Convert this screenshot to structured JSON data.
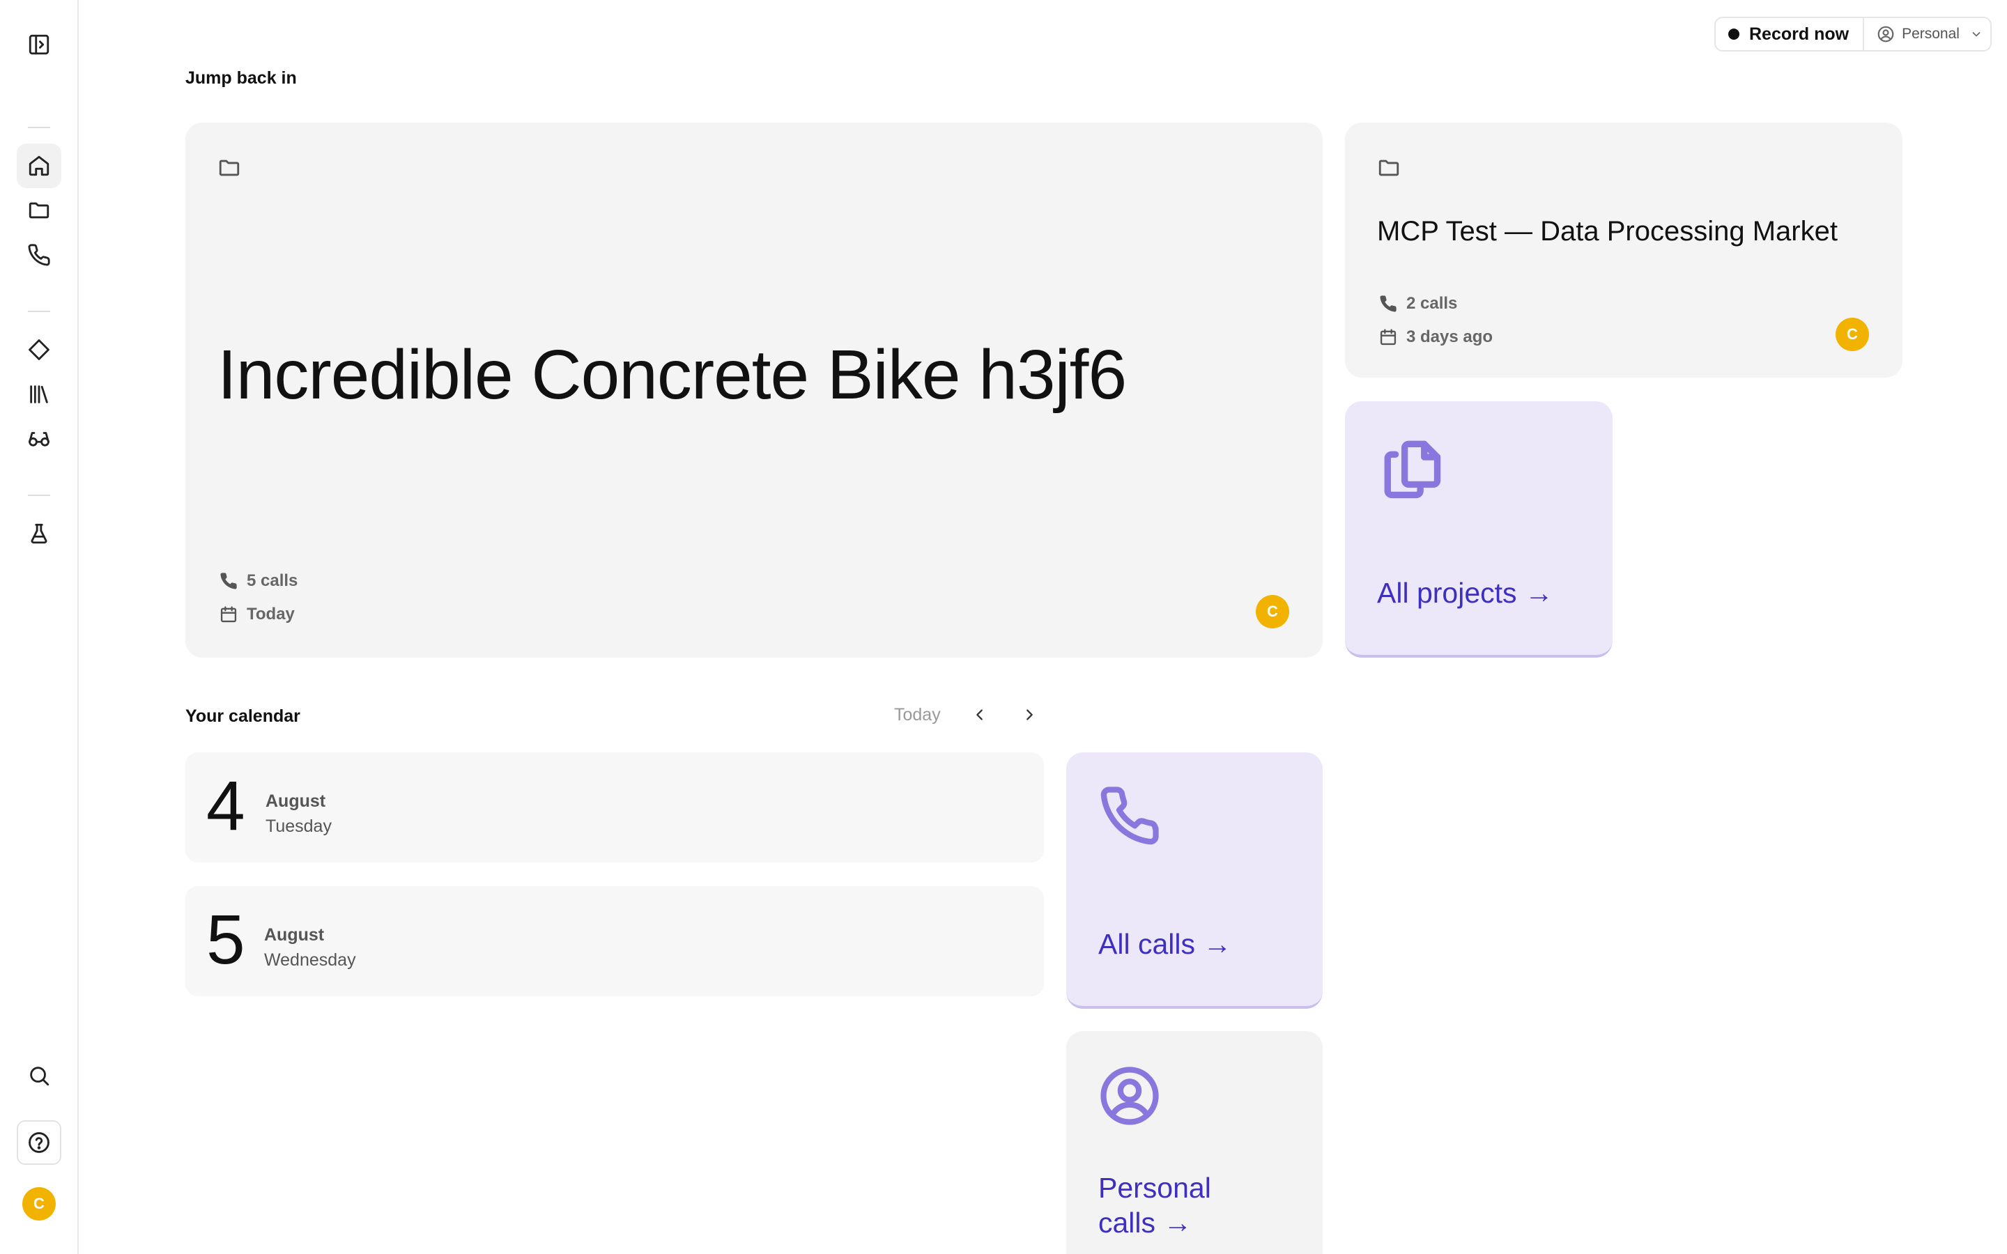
{
  "sidebar": {
    "items": [
      {
        "name": "toggle-sidebar",
        "icon": "panel-toggle-icon"
      },
      {
        "name": "home",
        "icon": "home-icon",
        "active": true
      },
      {
        "name": "projects",
        "icon": "folder-icon"
      },
      {
        "name": "calls",
        "icon": "phone-icon"
      },
      {
        "name": "tags",
        "icon": "diamond-icon"
      },
      {
        "name": "library",
        "icon": "library-icon"
      },
      {
        "name": "glasses",
        "icon": "glasses-icon"
      },
      {
        "name": "labs",
        "icon": "flask-icon"
      },
      {
        "name": "search",
        "icon": "search-icon"
      },
      {
        "name": "help",
        "icon": "help-icon"
      }
    ],
    "user_initial": "C"
  },
  "topbar": {
    "record_label": "Record now",
    "workspace_label": "Personal"
  },
  "jump_back": {
    "title": "Jump back in",
    "featured_project": {
      "title": "Incredible Concrete Bike h3jf6",
      "calls": "5 calls",
      "date": "Today",
      "owner_initial": "C"
    },
    "secondary_project": {
      "title": "MCP Test — Data Processing Market",
      "calls": "2 calls",
      "date": "3 days ago",
      "owner_initial": "C"
    },
    "all_projects_label": "All projects →"
  },
  "calendar": {
    "title": "Your calendar",
    "today_label": "Today",
    "days": [
      {
        "day": "4",
        "month": "August",
        "weekday": "Tuesday"
      },
      {
        "day": "5",
        "month": "August",
        "weekday": "Wednesday"
      }
    ]
  },
  "links": {
    "all_calls_label": "All calls →",
    "personal_calls_line1": "Personal",
    "personal_calls_line2": "calls →"
  },
  "colors": {
    "accent": "#3f2fbf",
    "accent_icon": "#8a77de",
    "link_card_bg": "#ece8fa",
    "avatar": "#f2b200"
  }
}
